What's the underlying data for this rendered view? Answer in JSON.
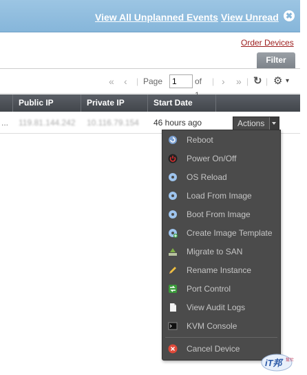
{
  "banner": {
    "view_all": "View All Unplanned Events",
    "view_unread": "View Unread",
    "close_glyph": "✖"
  },
  "order_devices": "Order Devices",
  "filter_tab": "Filter",
  "pager": {
    "first": "«",
    "prev": "‹",
    "next": "›",
    "last": "»",
    "page_label": "Page",
    "page_value": "1",
    "of_label": "of 1",
    "refresh_glyph": "↻",
    "gear_glyph": "⚙",
    "gear_caret": "▾"
  },
  "table": {
    "columns": [
      "Public IP",
      "Private IP",
      "Start Date"
    ],
    "row": {
      "lead": "...",
      "public_ip": "119.81.144.242",
      "private_ip": "10.116.79.154",
      "start_date": "46 hours ago",
      "actions_label": "Actions"
    }
  },
  "menu": {
    "items": [
      {
        "label": "Reboot",
        "icon": "reboot-icon"
      },
      {
        "label": "Power On/Off",
        "icon": "power-icon"
      },
      {
        "label": "OS Reload",
        "icon": "disc-icon"
      },
      {
        "label": "Load From Image",
        "icon": "disc-icon"
      },
      {
        "label": "Boot From Image",
        "icon": "disc-icon"
      },
      {
        "label": "Create Image Template",
        "icon": "disc-add-icon"
      },
      {
        "label": "Migrate to SAN",
        "icon": "migrate-icon"
      },
      {
        "label": "Rename Instance",
        "icon": "pencil-icon"
      },
      {
        "label": "Port Control",
        "icon": "port-icon"
      },
      {
        "label": "View Audit Logs",
        "icon": "document-icon"
      },
      {
        "label": "KVM Console",
        "icon": "console-icon"
      },
      {
        "label": "Cancel Device",
        "icon": "cancel-icon"
      }
    ]
  },
  "watermark": {
    "text": "iT邦",
    "subtext": "幫忙"
  },
  "colors": {
    "banner": "#8fbde0",
    "header_dark": "#4a4e54",
    "menu_bg": "#4b4b4b",
    "link_red": "#9b1b1b"
  }
}
